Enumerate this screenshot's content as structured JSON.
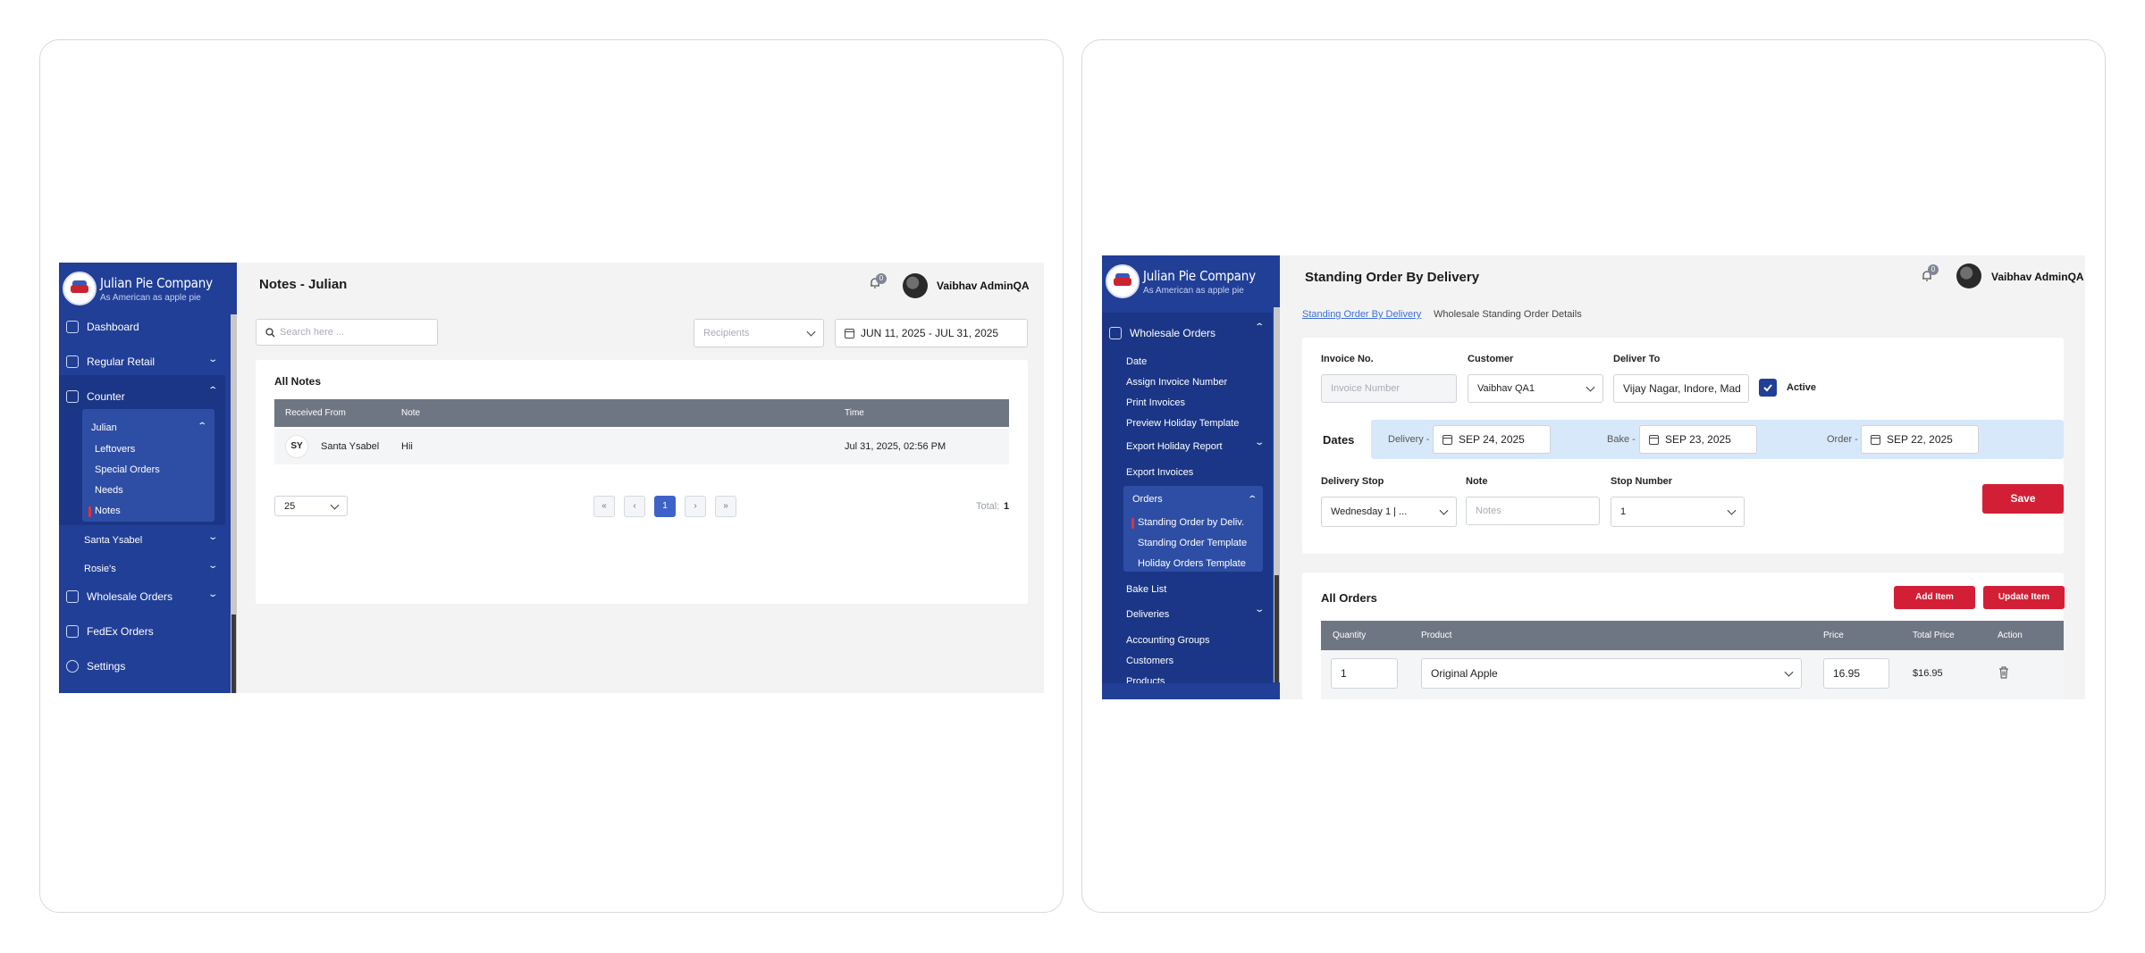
{
  "left": {
    "brand": {
      "name": "Julian Pie Company",
      "tagline": "As American as apple pie"
    },
    "sidebar": {
      "dashboard": "Dashboard",
      "regular_retail": "Regular Retail",
      "counter": "Counter",
      "julian": "Julian",
      "julian_items": [
        "Leftovers",
        "Special Orders",
        "Needs",
        "Notes"
      ],
      "santa_ysabel": "Santa Ysabel",
      "rosies": "Rosie's",
      "wholesale_orders": "Wholesale Orders",
      "fedex_orders": "FedEx Orders",
      "settings": "Settings"
    },
    "header": {
      "title": "Notes - Julian",
      "notification_count": "0",
      "user": "Vaibhav AdminQA"
    },
    "filters": {
      "search_placeholder": "Search here ...",
      "recipients_placeholder": "Recipients",
      "date_range": "JUN 11, 2025 - JUL 31, 2025"
    },
    "notes": {
      "heading": "All Notes",
      "columns": [
        "Received From",
        "Note",
        "Time"
      ],
      "rows": [
        {
          "initials": "SY",
          "from": "Santa Ysabel",
          "note": "Hii",
          "time": "Jul 31, 2025, 02:56 PM"
        }
      ]
    },
    "pagination": {
      "page_size": "25",
      "first": "«",
      "prev": "‹",
      "current": "1",
      "next": "›",
      "last": "»",
      "total_label": "Total:",
      "total": "1"
    }
  },
  "right": {
    "brand": {
      "name": "Julian Pie Company",
      "tagline": "As American as apple pie"
    },
    "sidebar": {
      "wholesale_orders": "Wholesale Orders",
      "items": [
        "Date",
        "Assign Invoice Number",
        "Print Invoices",
        "Preview Holiday Template",
        "Export Holiday Report",
        "Export Invoices"
      ],
      "orders": "Orders",
      "orders_items": [
        "Standing Order by Deliv.",
        "Standing Order Template",
        "Holiday Orders Template"
      ],
      "bake_list": "Bake List",
      "deliveries": "Deliveries",
      "accounting_groups": "Accounting Groups",
      "customers": "Customers",
      "products": "Products"
    },
    "header": {
      "title": "Standing Order By Delivery",
      "notification_count": "0",
      "user": "Vaibhav AdminQA"
    },
    "breadcrumb": {
      "link": "Standing Order By Delivery",
      "current": "Wholesale Standing Order Details"
    },
    "form": {
      "invoice_label": "Invoice No.",
      "invoice_placeholder": "Invoice Number",
      "customer_label": "Customer",
      "customer_value": "Vaibhav QA1",
      "deliver_to_label": "Deliver To",
      "deliver_to_value": "Vijay Nagar, Indore, Mad",
      "active_label": "Active",
      "dates_label": "Dates",
      "delivery_label": "Delivery -",
      "delivery_date": "SEP 24, 2025",
      "bake_label": "Bake -",
      "bake_date": "SEP 23, 2025",
      "order_label": "Order -",
      "order_date": "SEP 22, 2025",
      "delivery_stop_label": "Delivery Stop",
      "delivery_stop_value": "Wednesday 1 | ...",
      "note_label": "Note",
      "note_placeholder": "Notes",
      "stop_number_label": "Stop Number",
      "stop_number_value": "1",
      "save": "Save"
    },
    "orders": {
      "heading": "All Orders",
      "add_item": "Add Item",
      "update_item": "Update Item",
      "columns": [
        "Quantity",
        "Product",
        "Price",
        "Total Price",
        "Action"
      ],
      "rows": [
        {
          "quantity": "1",
          "product": "Original Apple",
          "price": "16.95",
          "total": "$16.95"
        }
      ]
    }
  }
}
